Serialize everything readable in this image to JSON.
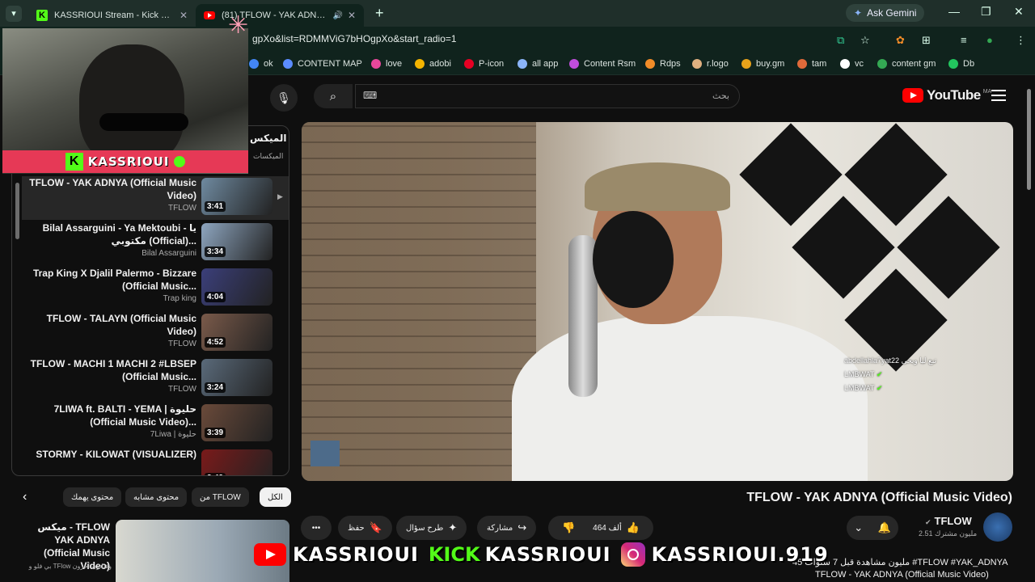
{
  "browser": {
    "tabs": [
      {
        "title": "KASSRIOUI Stream - Kick Dashb"
      },
      {
        "title": "(81) TFLOW - YAK ADNYA ("
      }
    ],
    "ask_gemini": "Ask Gemini",
    "url": "gpXo&list=RDMMViG7bHOgpXo&start_radio=1",
    "bookmarks": [
      {
        "label": "ok",
        "color": "#4285f4"
      },
      {
        "label": "CONTENT MAP",
        "color": "#5b8cff"
      },
      {
        "label": "love",
        "color": "#e8479b"
      },
      {
        "label": "adobi",
        "color": "#f4b400"
      },
      {
        "label": "P-icon",
        "color": "#e60023"
      },
      {
        "label": "all app",
        "color": "#8ab4f8"
      },
      {
        "label": "Content Rsm",
        "color": "#c04ddb"
      },
      {
        "label": "Rdps",
        "color": "#f28c28"
      },
      {
        "label": "r.logo",
        "color": "#e0b080"
      },
      {
        "label": "buy.gm",
        "color": "#e8a21a"
      },
      {
        "label": "tam",
        "color": "#e06a3a"
      },
      {
        "label": "vc",
        "color": "#ffffff"
      },
      {
        "label": "content gm",
        "color": "#34a853"
      },
      {
        "label": "Db",
        "color": "#22c55e"
      }
    ]
  },
  "youtube": {
    "search_placeholder": "بحث",
    "logo_word": "YouTube",
    "region": "MA"
  },
  "webcam": {
    "name": "KASSRIOUI"
  },
  "playlist": {
    "title": "الميكس",
    "subtitle": "الميكسات",
    "items": [
      {
        "title": "TFLOW - YAK ADNYA (Official Music Video)",
        "channel": "TFLOW",
        "duration": "3:41",
        "thumb": "#6f8aa0"
      },
      {
        "title": "Bilal Assarguini - Ya Mektoubi - يا مكتوبي (Official)...",
        "channel": "Bilal Assarguini",
        "duration": "3:34",
        "thumb": "#8ea6c0"
      },
      {
        "title": "Trap King X Djalil Palermo - Bizzare (Official Music...",
        "channel": "Trap king",
        "duration": "4:04",
        "thumb": "#3b3f7a"
      },
      {
        "title": "TFLOW - TALAYN (Official Music Video)",
        "channel": "TFLOW",
        "duration": "4:52",
        "thumb": "#7a5a4a"
      },
      {
        "title": "TFLOW - MACHI 1 MACHI 2 #LBSEP (Official Music...",
        "channel": "TFLOW",
        "duration": "3:24",
        "thumb": "#5a6a7a"
      },
      {
        "title": "7LIWA ft. BALTI - YEMA | حليوة (Official Music Video)...",
        "channel": "7Liwa | حليوة",
        "duration": "3:39",
        "thumb": "#6a4a3a"
      },
      {
        "title": "STORMY - KILOWAT (VISUALIZER)",
        "channel": "",
        "duration": "2:49",
        "thumb": "#7a1a1a"
      }
    ]
  },
  "chips": [
    {
      "label": "الكل"
    },
    {
      "label": "من TFLOW"
    },
    {
      "label": "محتوى مشابه"
    },
    {
      "label": "محتوى يهمك"
    }
  ],
  "video": {
    "title": "TFLOW - YAK ADNYA (Official Music Video)",
    "channel": "TFLOW",
    "subscribers": "2.51 مليون مشترك",
    "likes": "464 ألف",
    "share": "مشاركة",
    "ask": "طرح سؤال",
    "save": "حفظ",
    "description_meta": "45 مليون مشاهدة  قبل 7 سنوات  #TFLOW #YAK_ADNYA",
    "description_title": "TFLOW - YAK ADNYA (Official Music Video)"
  },
  "chat": [
    {
      "user": "abdellahla7yat22",
      "msg": "تبع ليا وبحى"
    },
    {
      "user": "",
      "msg": "LMBWAT"
    },
    {
      "user": "",
      "msg": "LMBWAT"
    }
  ],
  "next_up": {
    "title": "ميكس - TFLOW YAK ADNYA (Official Music Video)",
    "sub": "بي فلو و TFlow وفنانون آخرون"
  },
  "overlay": {
    "yt_name": "KASSRIOUI",
    "kick_label": "KICK",
    "kick_name": "KASSRIOUI",
    "ig_name": "KASSRIOUI.919"
  }
}
